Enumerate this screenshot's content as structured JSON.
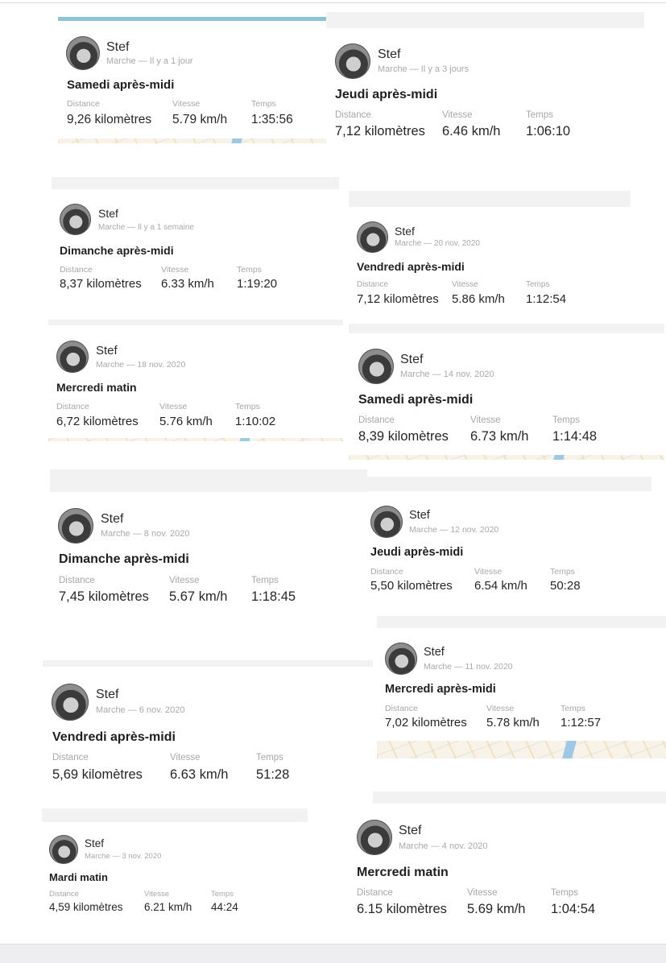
{
  "activities": [
    {
      "user": "Stef",
      "meta": "Marche — Il y a 1 jour",
      "title": "Samedi après-midi",
      "labels": [
        "Distance",
        "Vitesse",
        "Temps"
      ],
      "values": [
        "9,26 kilomètres",
        "5.79 km/h",
        "1:35:56"
      ]
    },
    {
      "user": "Stef",
      "meta": "Marche — Il y a 3 jours",
      "title": "Jeudi après-midi",
      "labels": [
        "Distance",
        "Vitesse",
        "Temps"
      ],
      "values": [
        "7,12 kilomètres",
        "6.46 km/h",
        "1:06:10"
      ]
    },
    {
      "user": "Stef",
      "meta": "Marche — Il y a 1 semaine",
      "title": "Dimanche après-midi",
      "labels": [
        "Distance",
        "Vitesse",
        "Temps"
      ],
      "values": [
        "8,37 kilomètres",
        "6.33 km/h",
        "1:19:20"
      ]
    },
    {
      "user": "Stef",
      "meta": "Marche — 20 nov. 2020",
      "title": "Vendredi après-midi",
      "labels": [
        "Distance",
        "Vitesse",
        "Temps"
      ],
      "values": [
        "7,12 kilomètres",
        "5.86 km/h",
        "1:12:54"
      ]
    },
    {
      "user": "Stef",
      "meta": "Marche — 18 nov. 2020",
      "title": "Mercredi matin",
      "labels": [
        "Distance",
        "Vitesse",
        "Temps"
      ],
      "values": [
        "6,72 kilomètres",
        "5.76 km/h",
        "1:10:02"
      ]
    },
    {
      "user": "Stef",
      "meta": "Marche — 14 nov. 2020",
      "title": "Samedi après-midi",
      "labels": [
        "Distance",
        "Vitesse",
        "Temps"
      ],
      "values": [
        "8,39 kilomètres",
        "6.73 km/h",
        "1:14:48"
      ]
    },
    {
      "user": "Stef",
      "meta": "Marche — 8 nov. 2020",
      "title": "Dimanche après-midi",
      "labels": [
        "Distance",
        "Vitesse",
        "Temps"
      ],
      "values": [
        "7,45 kilomètres",
        "5.67 km/h",
        "1:18:45"
      ]
    },
    {
      "user": "Stef",
      "meta": "Marche — 12 nov. 2020",
      "title": "Jeudi après-midi",
      "labels": [
        "Distance",
        "Vitesse",
        "Temps"
      ],
      "values": [
        "5,50 kilomètres",
        "6.54 km/h",
        "50:28"
      ]
    },
    {
      "user": "Stef",
      "meta": "Marche — 11 nov. 2020",
      "title": "Mercredi après-midi",
      "labels": [
        "Distance",
        "Vitesse",
        "Temps"
      ],
      "values": [
        "7,02 kilomètres",
        "5.78 km/h",
        "1:12:57"
      ]
    },
    {
      "user": "Stef",
      "meta": "Marche — 6 nov. 2020",
      "title": "Vendredi après-midi",
      "labels": [
        "Distance",
        "Vitesse",
        "Temps"
      ],
      "values": [
        "5,69 kilomètres",
        "6.63 km/h",
        "51:28"
      ]
    },
    {
      "user": "Stef",
      "meta": "Marche — 3 nov. 2020",
      "title": "Mardi matin",
      "labels": [
        "Distance",
        "Vitesse",
        "Temps"
      ],
      "values": [
        "4,59 kilomètres",
        "6.21 km/h",
        "44:24"
      ]
    },
    {
      "user": "Stef",
      "meta": "Marche — 4 nov. 2020",
      "title": "Mercredi matin",
      "labels": [
        "Distance",
        "Vitesse",
        "Temps"
      ],
      "values": [
        "6.15 kilomètres",
        "5.69 km/h",
        "1:04:54"
      ]
    }
  ],
  "colors": {
    "accent": "#8ec5d6",
    "muted": "#a9a9a9",
    "text": "#222222"
  }
}
